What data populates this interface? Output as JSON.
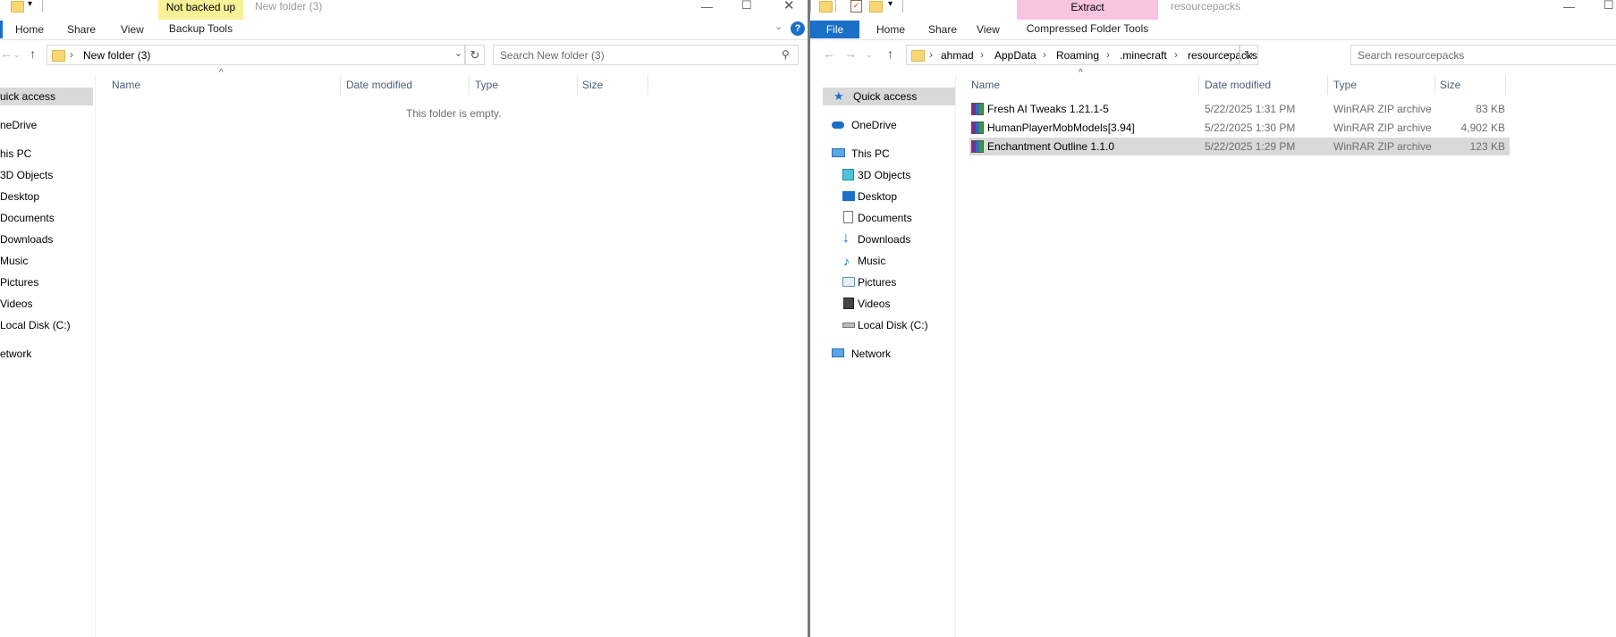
{
  "left": {
    "title": "New folder (3)",
    "ctx_tab": "Not backed up",
    "ctx_sub": "Backup Tools",
    "tabs": [
      "Home",
      "Share",
      "View"
    ],
    "breadcrumb": "New folder (3)",
    "search_placeholder": "Search New folder (3)",
    "columns": [
      "Name",
      "Date modified",
      "Type",
      "Size"
    ],
    "empty_text": "This folder is empty.",
    "nav": [
      "uick access",
      "neDrive",
      "his PC",
      "3D Objects",
      "Desktop",
      "Documents",
      "Downloads",
      "Music",
      "Pictures",
      "Videos",
      "Local Disk (C:)",
      "etwork"
    ]
  },
  "right": {
    "title": "resourcepacks",
    "ctx_tab": "Extract",
    "ctx_sub": "Compressed Folder Tools",
    "file_tab": "File",
    "tabs": [
      "Home",
      "Share",
      "View"
    ],
    "breadcrumbs": [
      "ahmad",
      "AppData",
      "Roaming",
      ".minecraft",
      "resourcepacks"
    ],
    "search_placeholder": "Search resourcepacks",
    "columns": [
      "Name",
      "Date modified",
      "Type",
      "Size"
    ],
    "nav": [
      "Quick access",
      "OneDrive",
      "This PC",
      "3D Objects",
      "Desktop",
      "Documents",
      "Downloads",
      "Music",
      "Pictures",
      "Videos",
      "Local Disk (C:)",
      "Network"
    ],
    "files": [
      {
        "name": "Fresh AI Tweaks 1.21.1-5",
        "date": "5/22/2025 1:31 PM",
        "type": "WinRAR ZIP archive",
        "size": "83 KB"
      },
      {
        "name": "HumanPlayerMobModels[3.94]",
        "date": "5/22/2025 1:30 PM",
        "type": "WinRAR ZIP archive",
        "size": "4,902 KB"
      },
      {
        "name": "Enchantment Outline 1.1.0",
        "date": "5/22/2025 1:29 PM",
        "type": "WinRAR ZIP archive",
        "size": "123 KB"
      }
    ]
  }
}
